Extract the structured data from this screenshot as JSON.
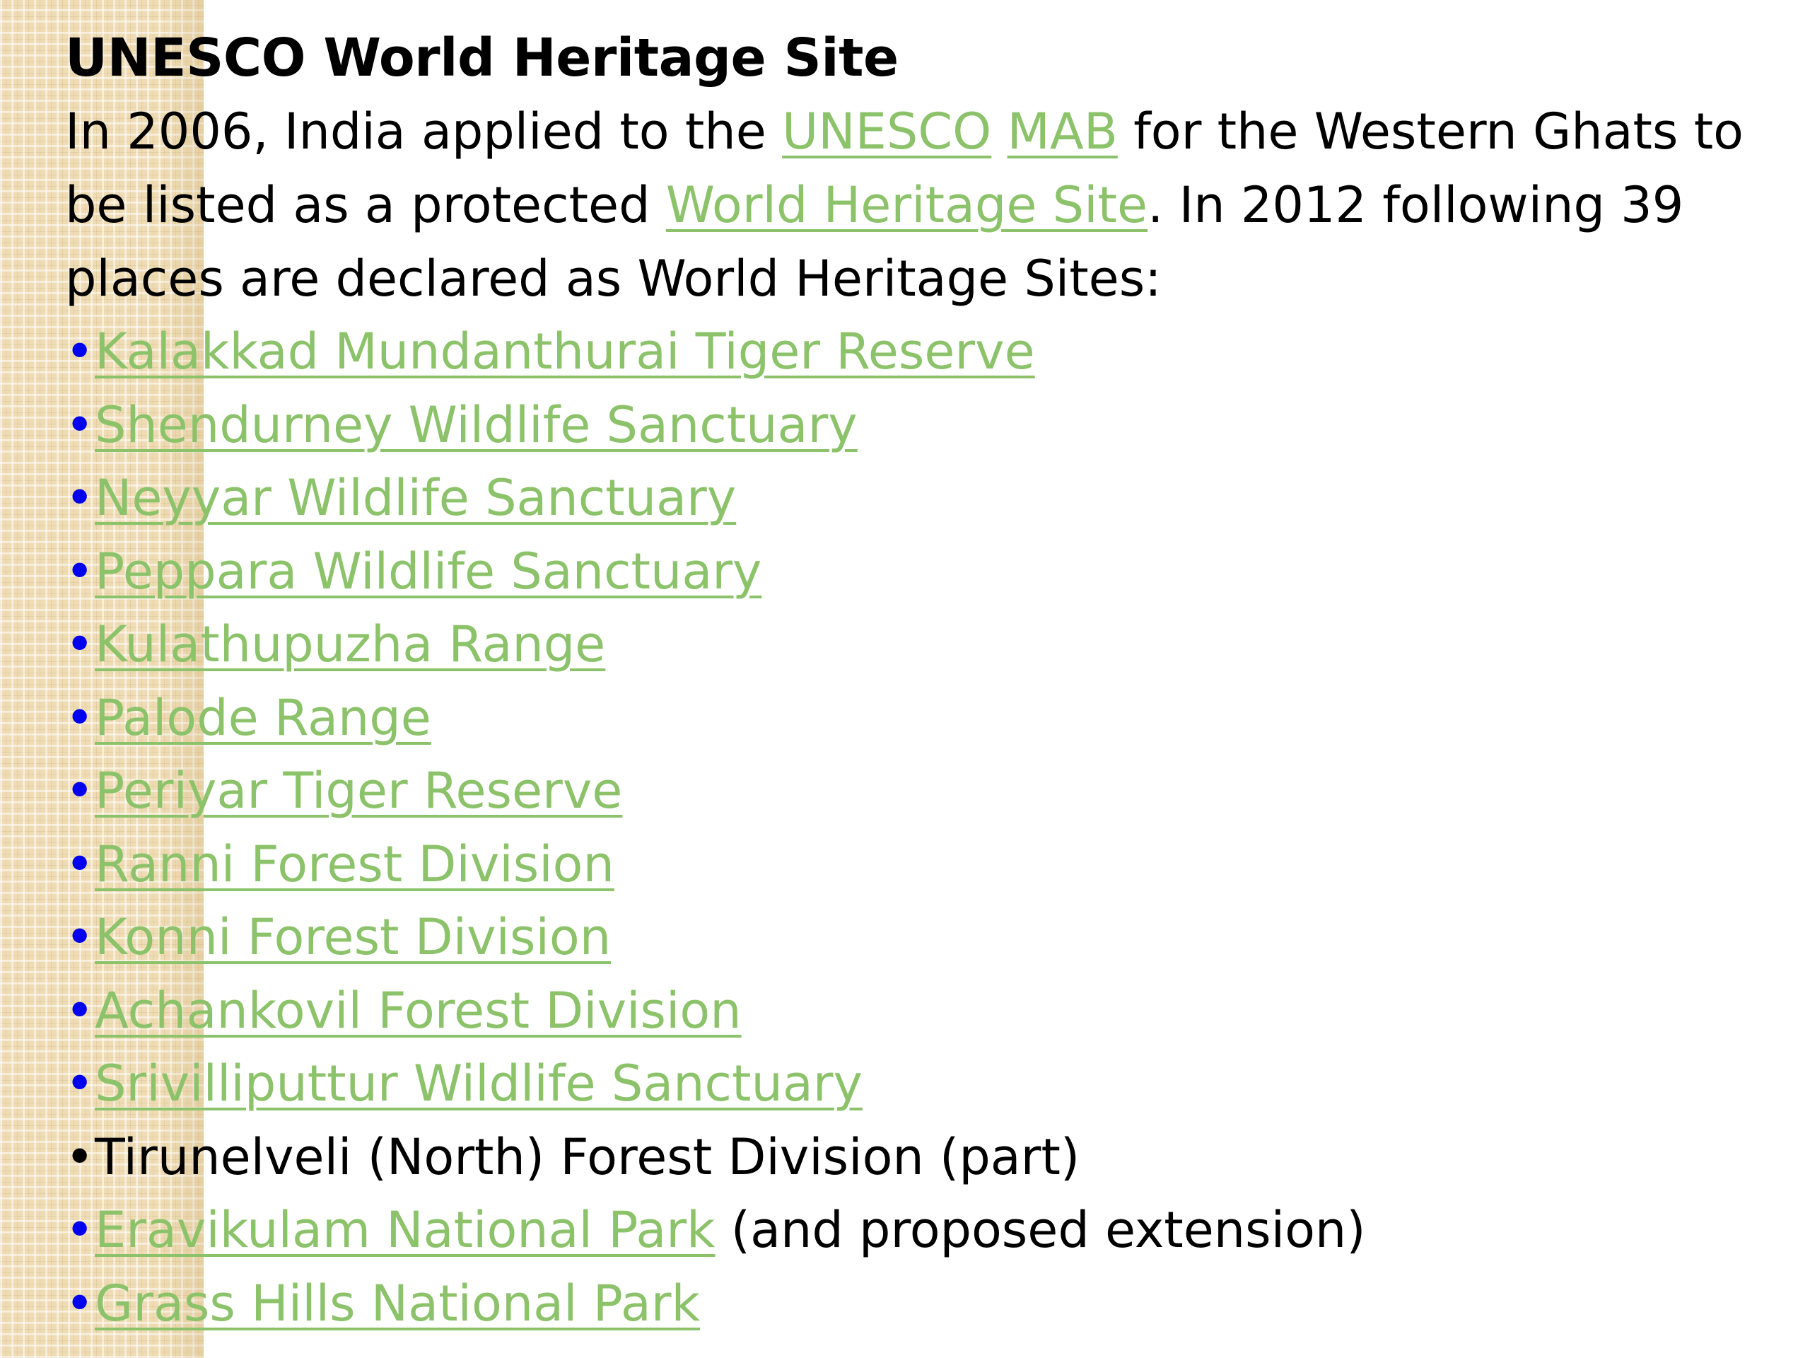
{
  "heading": "UNESCO World Heritage Site",
  "intro": {
    "t1": "In 2006, India applied to the ",
    "l1": "UNESCO",
    "t2": " ",
    "l2": "MAB",
    "t3": " for the Western Ghats to be listed as a protected ",
    "l3": "World Heritage Site",
    "t4": ". In 2012 following 39 places are declared as World Heritage Sites:"
  },
  "bullet_glyph": "•",
  "colors": {
    "link": "#8cc36a",
    "bullet_link": "#0000ee",
    "text": "#000000",
    "side_pattern": "#efdcb4"
  },
  "sites": [
    {
      "link": "Kalakkad Mundanthurai Tiger Reserve",
      "suffix": ""
    },
    {
      "link": "Shendurney Wildlife Sanctuary",
      "suffix": ""
    },
    {
      "link": "Neyyar Wildlife Sanctuary",
      "suffix": ""
    },
    {
      "link": "Peppara Wildlife Sanctuary",
      "suffix": ""
    },
    {
      "link": "Kulathupuzha Range",
      "suffix": ""
    },
    {
      "link": "Palode Range",
      "suffix": ""
    },
    {
      "link": "Periyar Tiger Reserve",
      "suffix": ""
    },
    {
      "link": "Ranni Forest Division",
      "suffix": ""
    },
    {
      "link": "Konni Forest Division",
      "suffix": ""
    },
    {
      "link": "Achankovil Forest Division",
      "suffix": ""
    },
    {
      "link": "Srivilliputtur Wildlife Sanctuary",
      "suffix": ""
    },
    {
      "text": "Tirunelveli (North) Forest Division (part)"
    },
    {
      "link": "Eravikulam National Park",
      "suffix": " (and proposed extension)"
    },
    {
      "link": "Grass Hills National Park",
      "suffix": ""
    }
  ]
}
